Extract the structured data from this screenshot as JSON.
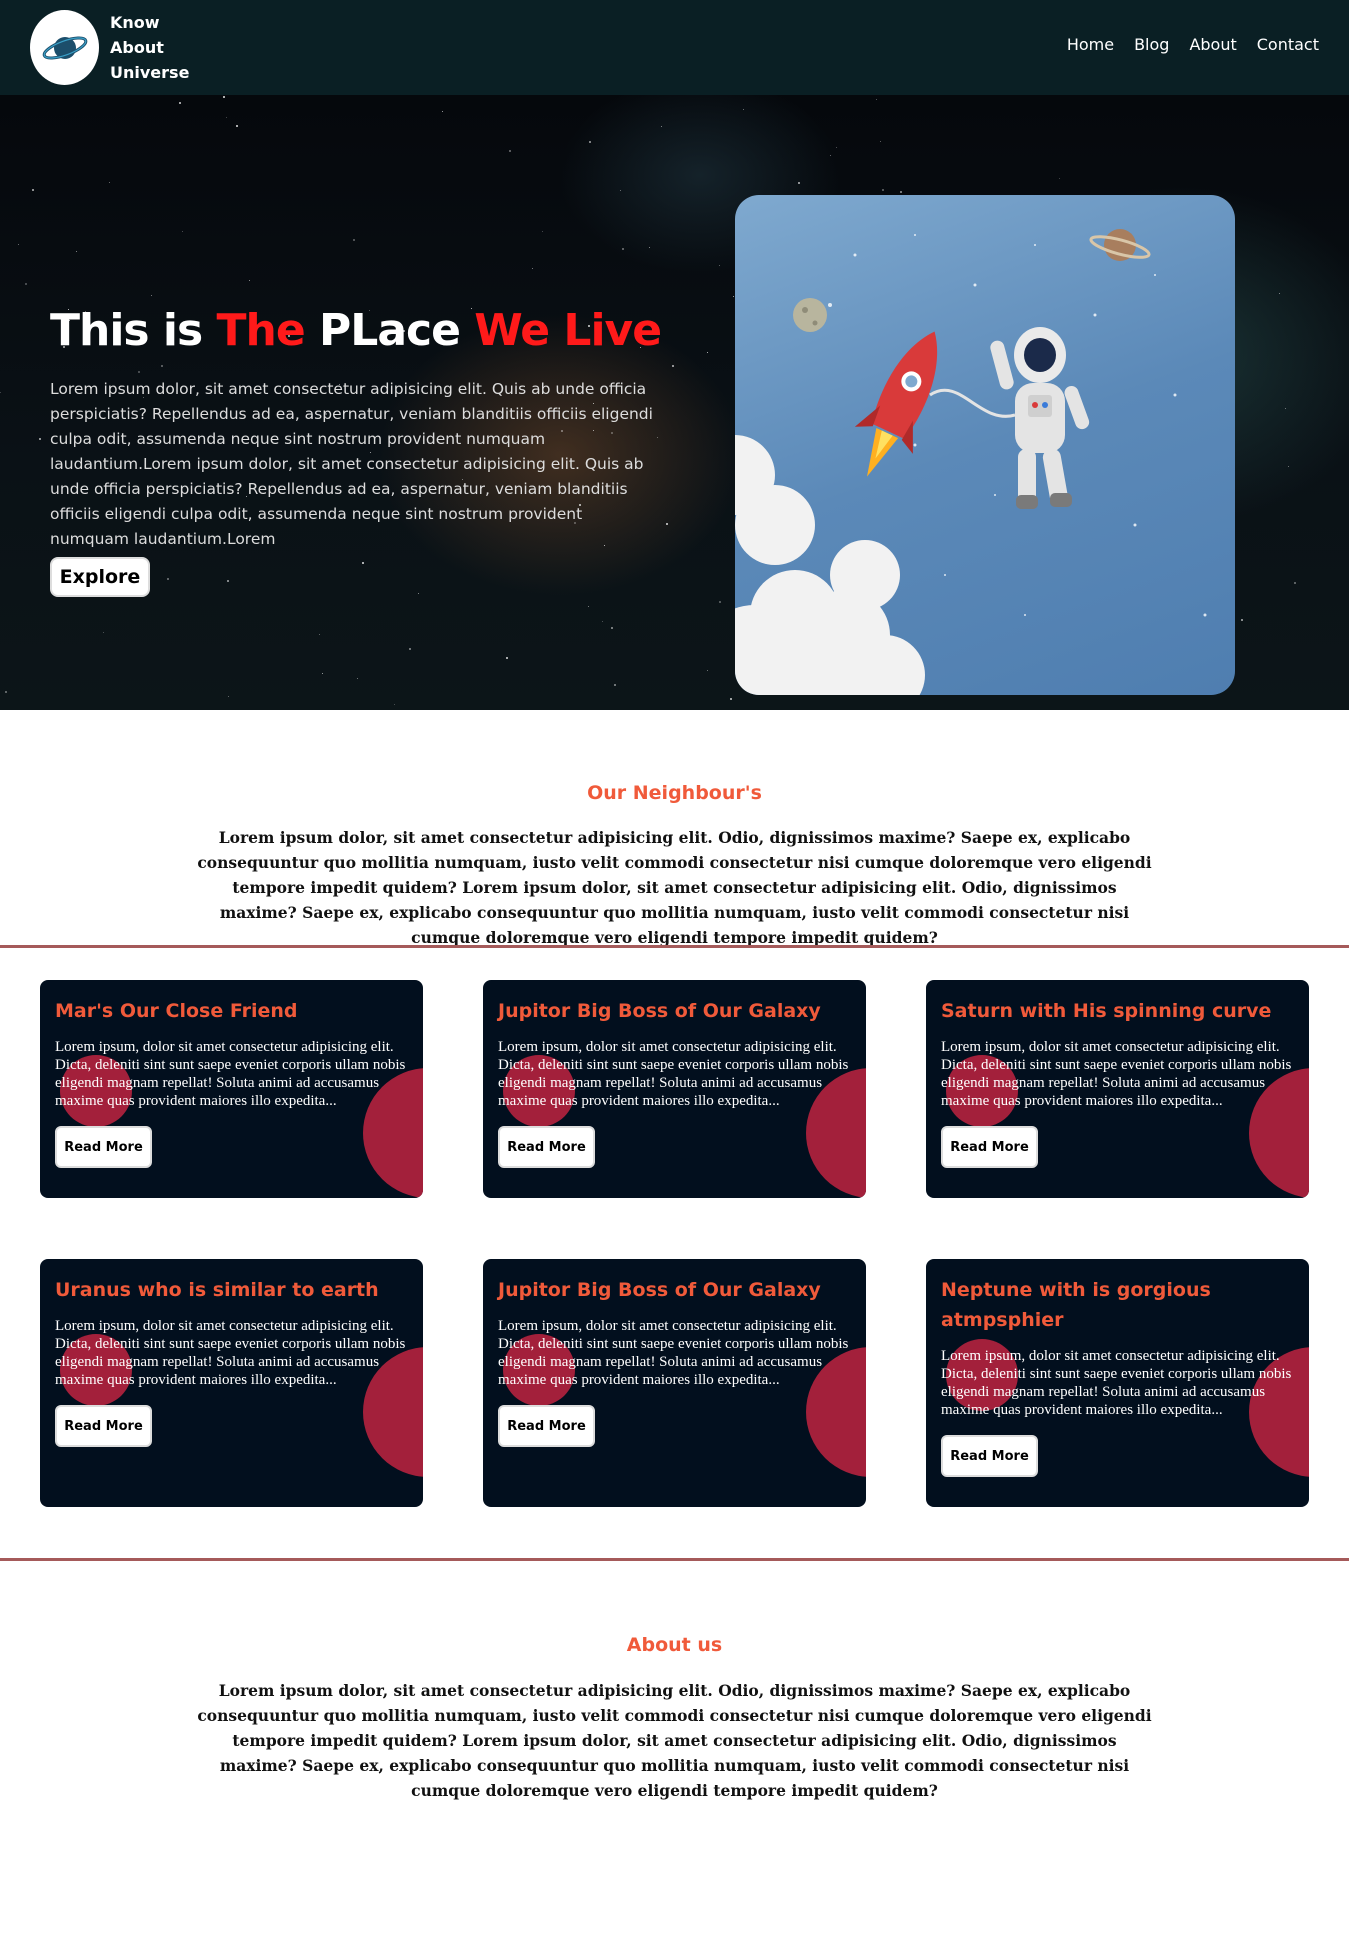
{
  "navbar": {
    "brand_line1": "Know",
    "brand_line2": "About",
    "brand_line3": "Universe",
    "links": [
      "Home",
      "Blog",
      "About",
      "Contact"
    ]
  },
  "hero": {
    "title_part1": "This is ",
    "title_part2": "The",
    "title_part3": " PLace ",
    "title_part4": "We",
    "title_part5": " ",
    "title_part6": "Live",
    "text": "Lorem ipsum dolor, sit amet consectetur adipisicing elit. Quis ab unde officia perspiciatis? Repellendus ad ea, aspernatur, veniam blanditiis officiis eligendi culpa odit, assumenda neque sint nostrum provident numquam laudantium.Lorem ipsum dolor, sit amet consectetur adipisicing elit. Quis ab unde officia perspiciatis? Repellendus ad ea, aspernatur, veniam blanditiis officiis eligendi culpa odit, assumenda neque sint nostrum provident numquam laudantium.Lorem",
    "button": "Explore"
  },
  "neighbours": {
    "title": "Our Neighbour's",
    "text": "Lorem ipsum dolor, sit amet consectetur adipisicing elit. Odio, dignissimos maxime? Saepe ex, explicabo consequuntur quo mollitia numquam, iusto velit commodi consectetur nisi cumque doloremque vero eligendi tempore impedit quidem? Lorem ipsum dolor, sit amet consectetur adipisicing elit. Odio, dignissimos maxime? Saepe ex, explicabo consequuntur quo mollitia numquam, iusto velit commodi consectetur nisi cumque doloremque vero eligendi tempore impedit quidem?"
  },
  "cards": [
    {
      "title": "Mar's Our Close Friend",
      "text": "Lorem ipsum, dolor sit amet consectetur adipisicing elit. Dicta, deleniti sint sunt saepe eveniet corporis ullam nobis eligendi magnam repellat! Soluta animi ad accusamus maxime quas provident maiores illo expedita...",
      "button": "Read More"
    },
    {
      "title": "Jupitor Big Boss of Our Galaxy",
      "text": "Lorem ipsum, dolor sit amet consectetur adipisicing elit. Dicta, deleniti sint sunt saepe eveniet corporis ullam nobis eligendi magnam repellat! Soluta animi ad accusamus maxime quas provident maiores illo expedita...",
      "button": "Read More"
    },
    {
      "title": "Saturn with His spinning curve",
      "text": "Lorem ipsum, dolor sit amet consectetur adipisicing elit. Dicta, deleniti sint sunt saepe eveniet corporis ullam nobis eligendi magnam repellat! Soluta animi ad accusamus maxime quas provident maiores illo expedita...",
      "button": "Read More"
    },
    {
      "title": "Uranus who is similar to earth",
      "text": "Lorem ipsum, dolor sit amet consectetur adipisicing elit. Dicta, deleniti sint sunt saepe eveniet corporis ullam nobis eligendi magnam repellat! Soluta animi ad accusamus maxime quas provident maiores illo expedita...",
      "button": "Read More"
    },
    {
      "title": "Jupitor Big Boss of Our Galaxy",
      "text": "Lorem ipsum, dolor sit amet consectetur adipisicing elit. Dicta, deleniti sint sunt saepe eveniet corporis ullam nobis eligendi magnam repellat! Soluta animi ad accusamus maxime quas provident maiores illo expedita...",
      "button": "Read More"
    },
    {
      "title": "Neptune with is gorgious atmpsphier",
      "text": "Lorem ipsum, dolor sit amet consectetur adipisicing elit. Dicta, deleniti sint sunt saepe eveniet corporis ullam nobis eligendi magnam repellat! Soluta animi ad accusamus maxime quas provident maiores illo expedita...",
      "button": "Read More"
    }
  ],
  "about": {
    "title": "About us",
    "text": "Lorem ipsum dolor, sit amet consectetur adipisicing elit. Odio, dignissimos maxime? Saepe ex, explicabo consequuntur quo mollitia numquam, iusto velit commodi consectetur nisi cumque doloremque vero eligendi tempore impedit quidem? Lorem ipsum dolor, sit amet consectetur adipisicing elit. Odio, dignissimos maxime? Saepe ex, explicabo consequuntur quo mollitia numquam, iusto velit commodi consectetur nisi cumque doloremque vero eligendi tempore impedit quidem?"
  },
  "colors": {
    "navbar": "#0a1f24",
    "accent": "#f05a3a",
    "hero_red": "#ff1a1a",
    "card_bg": "#020f1e",
    "card_blob": "#a3203b",
    "divider": "#a55a5a"
  },
  "icons": {
    "logo": "orbit-logo-icon"
  }
}
